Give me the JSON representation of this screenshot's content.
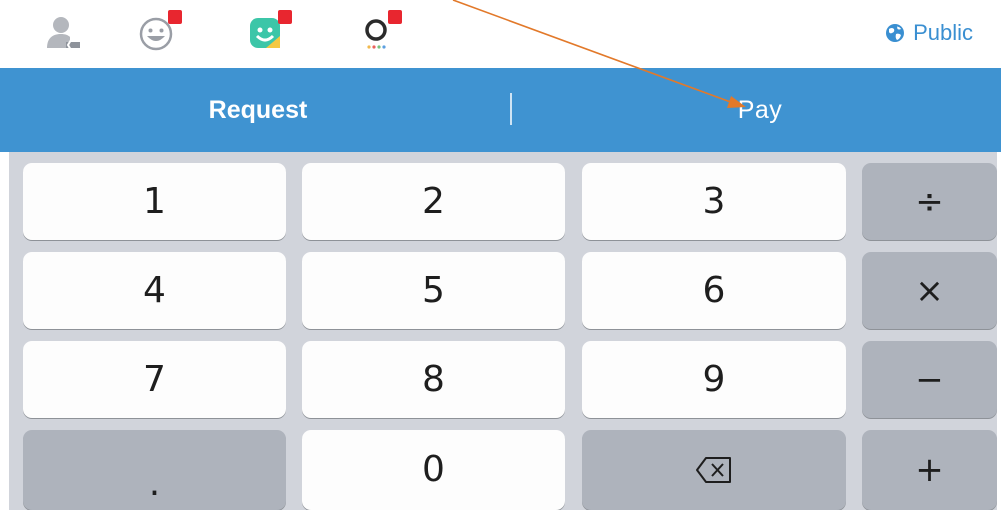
{
  "toolbar": {
    "icons": [
      {
        "name": "contact-icon",
        "has_badge": false
      },
      {
        "name": "emoji-icon",
        "has_badge": true
      },
      {
        "name": "sticker-icon",
        "has_badge": true
      },
      {
        "name": "color-picker-icon",
        "has_badge": true
      }
    ],
    "privacy": {
      "icon": "globe-icon",
      "label": "Public"
    },
    "accent_color": "#3a8fd1",
    "badge_color": "#e8262f"
  },
  "actionbar": {
    "request_label": "Request",
    "pay_label": "Pay",
    "background_color": "#3f93d1"
  },
  "keypad": {
    "row1": [
      "1",
      "2",
      "3",
      "÷"
    ],
    "row2": [
      "4",
      "5",
      "6",
      "×"
    ],
    "row3": [
      "7",
      "8",
      "9",
      "−"
    ],
    "row4": [
      ".",
      "0",
      "backspace-icon",
      "+"
    ]
  }
}
